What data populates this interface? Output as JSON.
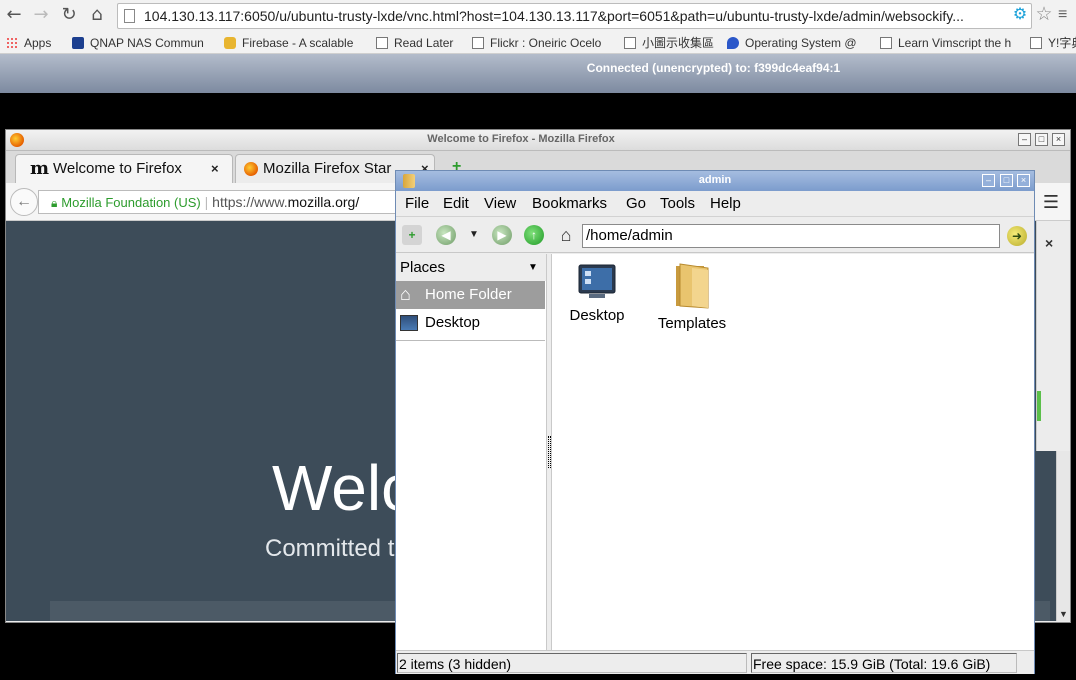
{
  "chrome": {
    "url": "104.130.13.117:6050/u/ubuntu-trusty-lxde/vnc.html?host=104.130.13.117&port=6051&path=u/ubuntu-trusty-lxde/admin/websockify...",
    "bookmarks": [
      {
        "label": "Apps"
      },
      {
        "label": "QNAP NAS Commun"
      },
      {
        "label": "Firebase - A scalable"
      },
      {
        "label": "Read Later"
      },
      {
        "label": "Flickr : Oneiric Ocelo"
      },
      {
        "label": "小圖示收集區"
      },
      {
        "label": "Operating System @"
      },
      {
        "label": "Learn Vimscript the h"
      },
      {
        "label": "Y!字典"
      }
    ]
  },
  "vnc": {
    "status": "Connected (unencrypted) to: f399dc4eaf94:1"
  },
  "firefox": {
    "window_title": "Welcome to Firefox - Mozilla Firefox",
    "tabs": [
      {
        "label": "Welcome to Firefox",
        "close": "×"
      },
      {
        "label": "Mozilla Firefox Star",
        "close": "×"
      }
    ],
    "identity": "Mozilla Foundation (US)",
    "url_prefix": "https://www.",
    "url_host": "mozilla.org/",
    "welcome_heading": "Welco",
    "welcome_sub": "Committed t",
    "panel_close": "×"
  },
  "filemanager": {
    "window_title": "admin",
    "menus": [
      "File",
      "Edit",
      "View",
      "Bookmarks",
      "Go",
      "Tools",
      "Help"
    ],
    "path": "/home/admin",
    "places_header": "Places",
    "places": [
      {
        "label": "Home Folder",
        "selected": true
      },
      {
        "label": "Desktop",
        "selected": false
      }
    ],
    "files": [
      {
        "label": "Desktop"
      },
      {
        "label": "Templates"
      }
    ],
    "status_left": "2 items (3 hidden)",
    "status_right": "Free space: 15.9 GiB (Total: 19.6 GiB)"
  }
}
